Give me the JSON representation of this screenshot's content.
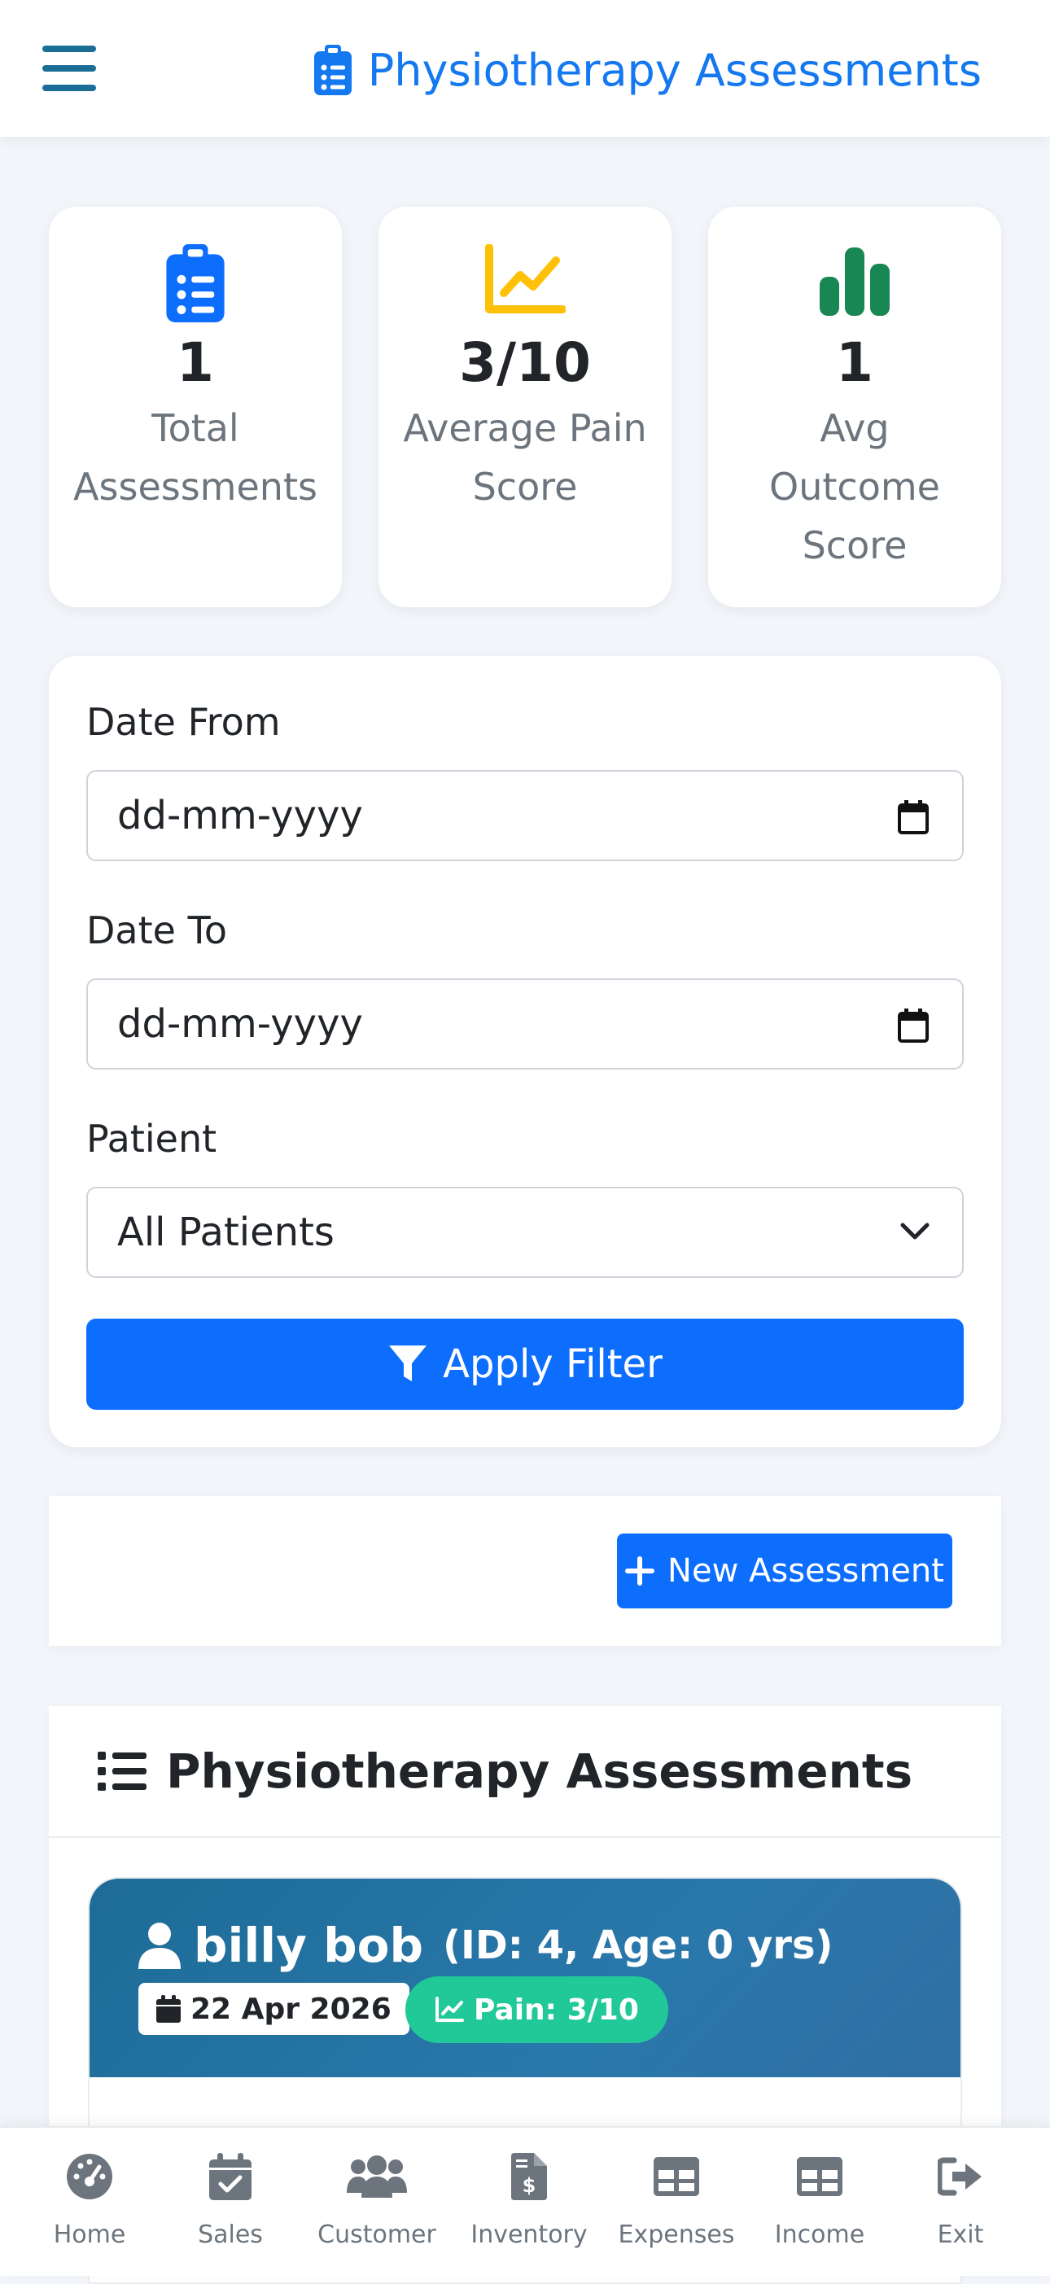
{
  "header": {
    "title": "Physiotherapy Assessments"
  },
  "stats": [
    {
      "value": "1",
      "label": "Total Assessments"
    },
    {
      "value": "3/10",
      "label": "Average Pain Score"
    },
    {
      "value": "1",
      "label": "Avg Outcome Score"
    }
  ],
  "colors": {
    "primary": "#0d6efd",
    "header_title": "#1478f0",
    "hamburger": "#1b6f96",
    "warning": "#ffc107",
    "success": "#198754",
    "pain_badge": "#20c997",
    "patient_header": "#1d6b96"
  },
  "filter": {
    "date_from_label": "Date From",
    "date_from_placeholder": "dd-mm-yyyy",
    "date_to_label": "Date To",
    "date_to_placeholder": "dd-mm-yyyy",
    "patient_label": "Patient",
    "patient_selected": "All Patients",
    "apply_label": "Apply Filter"
  },
  "actions": {
    "new_assessment_label": "New Assessment"
  },
  "list": {
    "title": "Physiotherapy Assessments",
    "items": [
      {
        "name": "billy bob",
        "meta": "(ID: 4, Age: 0 yrs)",
        "date": "22 Apr 2026",
        "pain": "Pain: 3/10"
      }
    ]
  },
  "nav": [
    {
      "label": "Home",
      "icon": "dashboard-icon"
    },
    {
      "label": "Sales",
      "icon": "calendar-check-icon"
    },
    {
      "label": "Customer",
      "icon": "users-icon"
    },
    {
      "label": "Inventory",
      "icon": "invoice-dollar-icon"
    },
    {
      "label": "Expenses",
      "icon": "table-icon"
    },
    {
      "label": "Income",
      "icon": "table-icon"
    },
    {
      "label": "Exit",
      "icon": "sign-out-icon"
    }
  ]
}
